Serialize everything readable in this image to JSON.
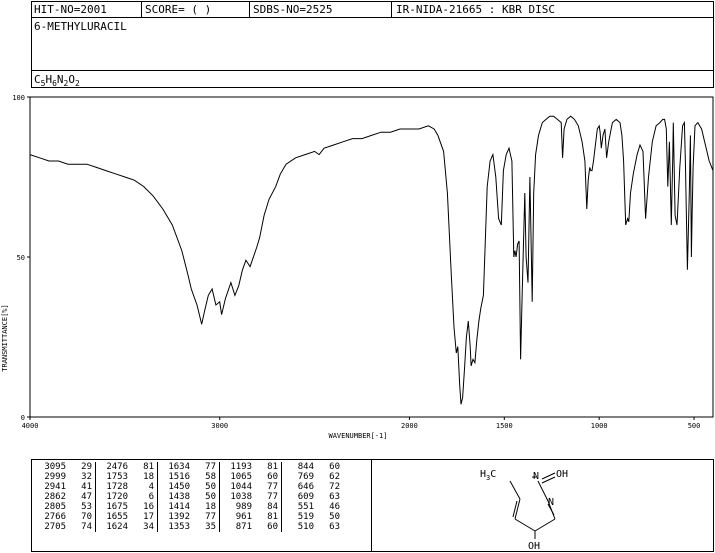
{
  "header": {
    "hit_no": "HIT-NO=2001",
    "score": "SCORE=  (   )",
    "sdbs_no": "SDBS-NO=2525",
    "ir_nida": "IR-NIDA-21665 : KBR DISC",
    "compound": "6-METHYLURACIL",
    "formula_c": "C",
    "formula_c_sub": "5",
    "formula_h": "H",
    "formula_h_sub": "6",
    "formula_n": "N",
    "formula_n_sub": "2",
    "formula_o": "O",
    "formula_o_sub": "2"
  },
  "structure": {
    "labels": [
      "H3C",
      "N",
      "OH",
      "N",
      "OH"
    ],
    "methyl": "H",
    "methyl_sub": "3",
    "methyl_c": "C",
    "n1": "N",
    "n2": "N",
    "oh1": "OH",
    "oh2": "OH"
  },
  "peaks": [
    [
      [
        "3095",
        "29"
      ],
      [
        "2999",
        "32"
      ],
      [
        "2941",
        "41"
      ],
      [
        "2862",
        "47"
      ],
      [
        "2805",
        "53"
      ],
      [
        "2766",
        "70"
      ],
      [
        "2705",
        "74"
      ]
    ],
    [
      [
        "2476",
        "81"
      ],
      [
        "1753",
        "18"
      ],
      [
        "1728",
        "4"
      ],
      [
        "1720",
        "6"
      ],
      [
        "1675",
        "16"
      ],
      [
        "1655",
        "17"
      ],
      [
        "1624",
        "34"
      ]
    ],
    [
      [
        "1634",
        "77"
      ],
      [
        "1516",
        "58"
      ],
      [
        "1450",
        "50"
      ],
      [
        "1438",
        "50"
      ],
      [
        "1414",
        "18"
      ],
      [
        "1392",
        "77"
      ],
      [
        "1353",
        "35"
      ]
    ],
    [
      [
        "1193",
        "81"
      ],
      [
        "1065",
        "60"
      ],
      [
        "1044",
        "77"
      ],
      [
        "1038",
        "77"
      ],
      [
        "989",
        "84"
      ],
      [
        "961",
        "81"
      ],
      [
        "871",
        "60"
      ]
    ],
    [
      [
        "844",
        "60"
      ],
      [
        "769",
        "62"
      ],
      [
        "646",
        "72"
      ],
      [
        "609",
        "63"
      ],
      [
        "551",
        "46"
      ],
      [
        "519",
        "50"
      ],
      [
        "510",
        "63"
      ]
    ]
  ],
  "chart_data": {
    "type": "line",
    "xlabel": "WAVENUMBER[-1]",
    "ylabel": "TRANSMITTANCE[%]",
    "xlim": [
      4000,
      400
    ],
    "ylim": [
      0,
      100
    ],
    "x_ticks": [
      4000,
      3000,
      2000,
      1500,
      1000,
      500
    ],
    "y_ticks": [
      0,
      50,
      100
    ],
    "series": [
      {
        "x": [
          4000,
          3950,
          3900,
          3850,
          3800,
          3750,
          3700,
          3650,
          3600,
          3550,
          3500,
          3450,
          3400,
          3350,
          3300,
          3250,
          3200,
          3170,
          3150,
          3120,
          3095,
          3080,
          3060,
          3040,
          3020,
          3000,
          2990,
          2970,
          2941,
          2920,
          2900,
          2880,
          2862,
          2840,
          2805,
          2790,
          2766,
          2740,
          2705,
          2680,
          2650,
          2600,
          2550,
          2500,
          2476,
          2450,
          2400,
          2350,
          2300,
          2250,
          2200,
          2150,
          2100,
          2050,
          2000,
          1950,
          1900,
          1870,
          1850,
          1820,
          1800,
          1780,
          1765,
          1753,
          1745,
          1735,
          1728,
          1720,
          1710,
          1700,
          1690,
          1680,
          1675,
          1665,
          1655,
          1645,
          1634,
          1624,
          1610,
          1600,
          1590,
          1575,
          1560,
          1545,
          1530,
          1516,
          1505,
          1490,
          1475,
          1460,
          1450,
          1444,
          1438,
          1430,
          1422,
          1414,
          1405,
          1392,
          1385,
          1375,
          1365,
          1353,
          1345,
          1335,
          1320,
          1300,
          1280,
          1260,
          1240,
          1220,
          1200,
          1193,
          1185,
          1170,
          1150,
          1130,
          1110,
          1090,
          1075,
          1065,
          1058,
          1050,
          1044,
          1038,
          1030,
          1020,
          1010,
          1000,
          995,
          989,
          980,
          970,
          961,
          950,
          930,
          910,
          890,
          880,
          871,
          860,
          850,
          844,
          835,
          820,
          800,
          785,
          769,
          755,
          740,
          720,
          700,
          680,
          665,
          655,
          646,
          638,
          630,
          620,
          612,
          609,
          600,
          590,
          575,
          560,
          551,
          545,
          535,
          525,
          519,
          514,
          510,
          505,
          495,
          480,
          460,
          440,
          420,
          400
        ],
        "y": [
          82,
          81,
          80,
          80,
          79,
          79,
          79,
          78,
          77,
          76,
          75,
          74,
          72,
          69,
          65,
          60,
          52,
          45,
          40,
          35,
          29,
          33,
          38,
          40,
          35,
          36,
          32,
          37,
          42,
          38,
          41,
          46,
          49,
          47,
          53,
          56,
          63,
          68,
          72,
          76,
          79,
          81,
          82,
          83,
          82,
          84,
          85,
          86,
          87,
          87,
          88,
          89,
          89,
          90,
          90,
          90,
          91,
          90,
          88,
          83,
          70,
          45,
          28,
          20,
          22,
          10,
          4,
          6,
          15,
          25,
          30,
          22,
          16,
          18,
          17,
          24,
          30,
          34,
          38,
          55,
          72,
          80,
          82,
          75,
          62,
          60,
          77,
          82,
          84,
          80,
          50,
          52,
          50,
          54,
          55,
          18,
          40,
          70,
          50,
          42,
          75,
          36,
          70,
          82,
          88,
          92,
          93,
          94,
          94,
          93,
          92,
          81,
          90,
          93,
          94,
          93,
          91,
          86,
          80,
          65,
          74,
          78,
          77,
          77,
          80,
          85,
          90,
          91,
          89,
          84,
          88,
          90,
          81,
          86,
          92,
          93,
          92,
          88,
          80,
          60,
          62,
          61,
          70,
          76,
          82,
          85,
          83,
          62,
          75,
          86,
          91,
          92,
          93,
          93,
          90,
          72,
          86,
          60,
          82,
          92,
          63,
          60,
          78,
          91,
          92,
          78,
          46,
          70,
          88,
          50,
          63,
          78,
          91,
          92,
          90,
          85,
          80,
          77
        ]
      }
    ]
  }
}
